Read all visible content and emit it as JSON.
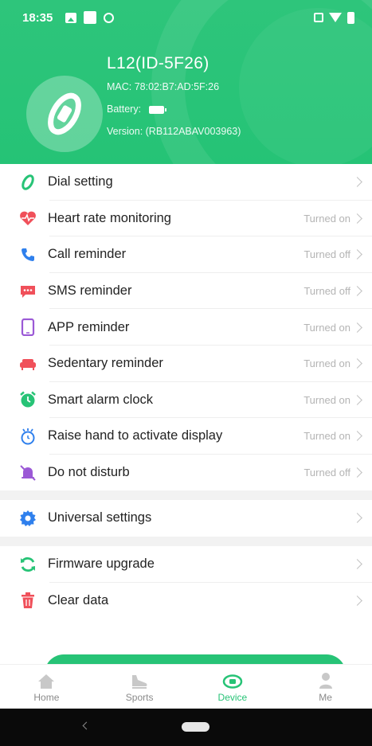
{
  "status_bar": {
    "time": "18:35"
  },
  "device": {
    "name": "L12(ID-5F26)",
    "mac": "MAC: 78:02:B7:AD:5F:26",
    "battery_label": "Battery:",
    "version": "Version: (RB112ABAV003963)"
  },
  "menu": {
    "items": [
      {
        "label": "Dial setting",
        "status": "",
        "icon": "dial-icon",
        "color": "#27c376"
      },
      {
        "label": "Heart rate monitoring",
        "status": "Turned on",
        "icon": "heart-icon",
        "color": "#f0505a"
      },
      {
        "label": "Call reminder",
        "status": "Turned off",
        "icon": "phone-icon",
        "color": "#2f80ed"
      },
      {
        "label": "SMS reminder",
        "status": "Turned off",
        "icon": "sms-icon",
        "color": "#f0505a"
      },
      {
        "label": "APP reminder",
        "status": "Turned on",
        "icon": "app-icon",
        "color": "#9b59d6"
      },
      {
        "label": "Sedentary reminder",
        "status": "Turned on",
        "icon": "sofa-icon",
        "color": "#f0505a"
      },
      {
        "label": "Smart alarm clock",
        "status": "Turned on",
        "icon": "alarm-icon",
        "color": "#27c376"
      },
      {
        "label": "Raise hand to activate display",
        "status": "Turned on",
        "icon": "raise-hand-icon",
        "color": "#2f80ed"
      },
      {
        "label": "Do not disturb",
        "status": "Turned off",
        "icon": "bell-off-icon",
        "color": "#9b59d6"
      }
    ],
    "universal": {
      "label": "Universal settings",
      "icon": "gear-icon",
      "color": "#2f80ed"
    },
    "firmware": {
      "label": "Firmware upgrade",
      "icon": "refresh-icon",
      "color": "#27c376"
    },
    "clear": {
      "label": "Clear data",
      "icon": "trash-icon",
      "color": "#f0505a"
    }
  },
  "tabs": [
    {
      "label": "Home",
      "icon": "home-icon",
      "active": false
    },
    {
      "label": "Sports",
      "icon": "shoe-icon",
      "active": false
    },
    {
      "label": "Device",
      "icon": "watch-icon",
      "active": true
    },
    {
      "label": "Me",
      "icon": "person-icon",
      "active": false
    }
  ],
  "colors": {
    "accent": "#27c376",
    "status_text": "#b4b4b4",
    "divider": "#f2f2f2"
  }
}
